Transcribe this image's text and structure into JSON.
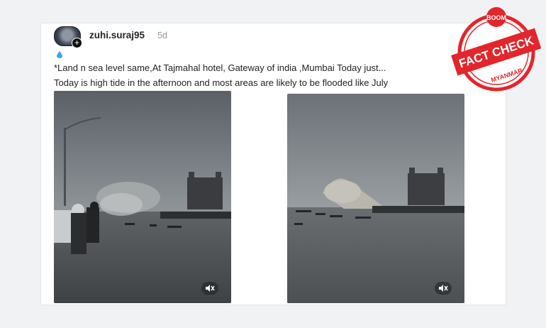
{
  "post": {
    "username": "zuhi.suraj95",
    "time": "5d",
    "caption_line1": "*Land n sea level same,At Tajmahal hotel, Gateway of india ,Mumbai Today just...",
    "caption_line2": "Today is high tide in the afternoon and most areas are likely to be flooded like July"
  },
  "badge": {
    "top": "BOOM",
    "main": "FACT CHECK",
    "bottom": "MYANMAR",
    "color": "#e2262b"
  },
  "icons": {
    "drop": "water-drop-icon",
    "mute": "muted-speaker-icon",
    "plus": "plus-icon"
  },
  "labels": {
    "plus": "+"
  }
}
